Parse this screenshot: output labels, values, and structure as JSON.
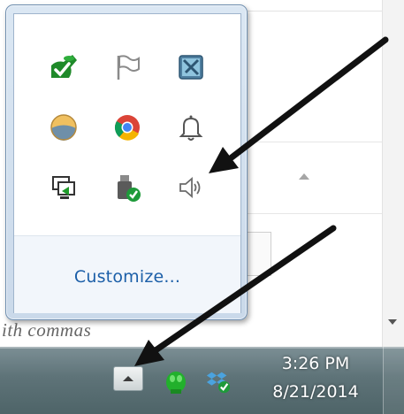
{
  "background": {
    "snippet_text": "ith commas"
  },
  "popup": {
    "icons": [
      {
        "name": "green-app-icon"
      },
      {
        "name": "action-center-flag-icon"
      },
      {
        "name": "blue-square-app-icon"
      },
      {
        "name": "round-app-icon"
      },
      {
        "name": "chrome-icon"
      },
      {
        "name": "notification-bell-icon"
      },
      {
        "name": "display-switch-icon"
      },
      {
        "name": "safely-remove-hardware-icon"
      },
      {
        "name": "volume-speaker-icon"
      }
    ],
    "customize_label": "Customize..."
  },
  "taskbar": {
    "show_hidden_icons_label": "Show hidden icons",
    "tray_icons": [
      {
        "name": "green-tray-app-icon"
      },
      {
        "name": "dropbox-sync-icon"
      }
    ],
    "clock_time": "3:26 PM",
    "clock_date": "8/21/2014"
  },
  "colors": {
    "link": "#1c5fa8",
    "annotation_arrow": "#111111"
  }
}
